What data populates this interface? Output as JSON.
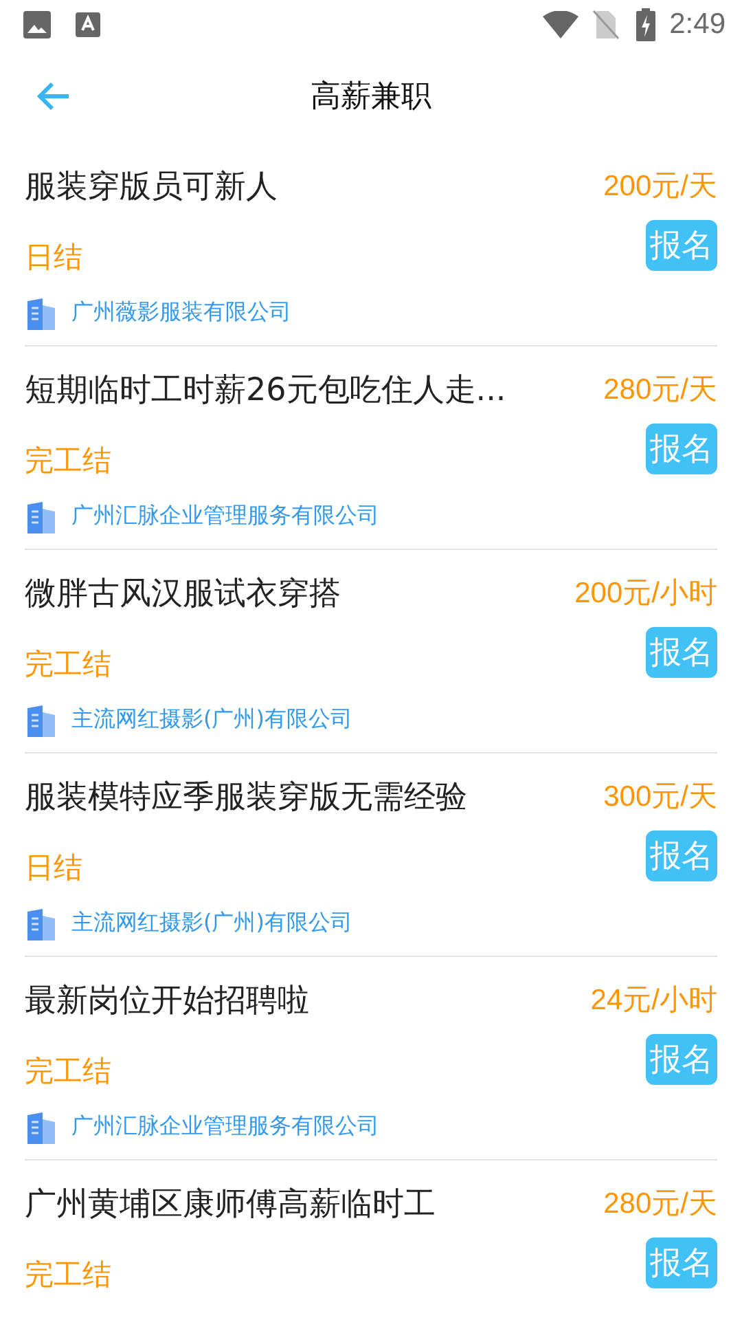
{
  "status_bar": {
    "time": "2:49"
  },
  "header": {
    "title": "高薪兼职"
  },
  "jobs": [
    {
      "title": "服装穿版员可新人",
      "pay": "200元/天",
      "settlement": "日结",
      "button": "报名",
      "company": "广州薇影服装有限公司"
    },
    {
      "title": "短期临时工时薪26元包吃住人走...",
      "pay": "280元/天",
      "settlement": "完工结",
      "button": "报名",
      "company": "广州汇脉企业管理服务有限公司"
    },
    {
      "title": "微胖古风汉服试衣穿搭",
      "pay": "200元/小时",
      "settlement": "完工结",
      "button": "报名",
      "company": "主流网红摄影(广州)有限公司"
    },
    {
      "title": "服装模特应季服装穿版无需经验",
      "pay": "300元/天",
      "settlement": "日结",
      "button": "报名",
      "company": "主流网红摄影(广州)有限公司"
    },
    {
      "title": "最新岗位开始招聘啦",
      "pay": "24元/小时",
      "settlement": "完工结",
      "button": "报名",
      "company": "广州汇脉企业管理服务有限公司"
    },
    {
      "title": "广州黄埔区康师傅高薪临时工",
      "pay": "280元/天",
      "settlement": "完工结",
      "button": "报名"
    }
  ]
}
